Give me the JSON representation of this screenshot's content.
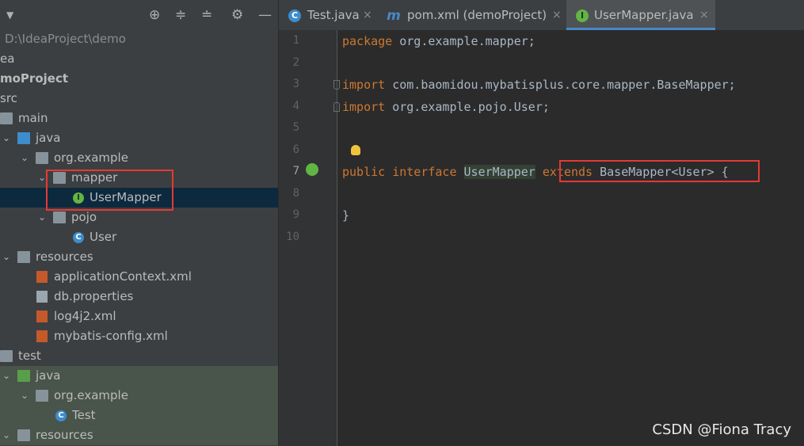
{
  "project_tree": {
    "path_label": "D:\\IdeaProject\\demo",
    "rows": [
      {
        "label": "ea"
      },
      {
        "label": "moProject"
      },
      {
        "label": "src"
      },
      {
        "label": "main"
      },
      {
        "label": "java"
      },
      {
        "label": "org.example"
      },
      {
        "label": "mapper"
      },
      {
        "label": "UserMapper"
      },
      {
        "label": "pojo"
      },
      {
        "label": "User"
      },
      {
        "label": "resources"
      },
      {
        "label": "applicationContext.xml"
      },
      {
        "label": "db.properties"
      },
      {
        "label": "log4j2.xml"
      },
      {
        "label": "mybatis-config.xml"
      },
      {
        "label": "test"
      },
      {
        "label": "java"
      },
      {
        "label": "org.example"
      },
      {
        "label": "Test"
      },
      {
        "label": "resources"
      }
    ]
  },
  "tabs": [
    {
      "label": "Test.java",
      "icon": "C",
      "close": "×"
    },
    {
      "label": "pom.xml (demoProject)",
      "icon": "m",
      "close": "×"
    },
    {
      "label": "UserMapper.java",
      "icon": "I",
      "close": "×"
    }
  ],
  "editor": {
    "line_numbers": [
      "1",
      "2",
      "3",
      "4",
      "5",
      "6",
      "7",
      "8",
      "9",
      "10"
    ],
    "line1": {
      "kw": "package",
      "rest": " org.example.mapper;"
    },
    "line3": {
      "kw": "import",
      "rest": " com.baomidou.mybatisplus.core.mapper.BaseMapper;"
    },
    "line4": {
      "kw": "import",
      "rest": " org.example.pojo.User;"
    },
    "line7": {
      "kw1": "public",
      "kw2": "interface",
      "name": "UserMapper",
      "kw3": "extends",
      "base": "BaseMapper<User>",
      "brace": "{"
    },
    "line9": {
      "brace": "}"
    }
  },
  "watermark": "CSDN @Fiona Tracy",
  "colors": {
    "keyword": "#cc7832",
    "highlight_box": "#e53935",
    "active_tab_underline": "#4a88c7"
  }
}
